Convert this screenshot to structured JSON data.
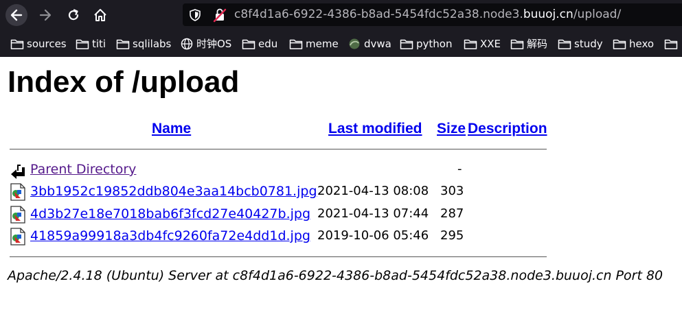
{
  "browser": {
    "url_prefix": "c8f4d1a6-6922-4386-b8ad-5454fdc52a38.node3.",
    "url_domain": "buuoj.cn",
    "url_path": "/upload/"
  },
  "bookmarks": [
    {
      "label": "sources",
      "icon": "folder-icon"
    },
    {
      "label": "titi",
      "icon": "folder-icon"
    },
    {
      "label": "sqlilabs",
      "icon": "folder-icon"
    },
    {
      "label": "时钟OS",
      "icon": "globe-icon"
    },
    {
      "label": "edu",
      "icon": "folder-icon"
    },
    {
      "label": "meme",
      "icon": "folder-icon"
    },
    {
      "label": "dvwa",
      "icon": "site-favicon-icon"
    },
    {
      "label": "python",
      "icon": "folder-icon"
    },
    {
      "label": "XXE",
      "icon": "folder-icon"
    },
    {
      "label": "解码",
      "icon": "folder-icon"
    },
    {
      "label": "study",
      "icon": "folder-icon"
    },
    {
      "label": "hexo",
      "icon": "folder-icon"
    }
  ],
  "page": {
    "title": "Index of /upload",
    "columns": {
      "name": "Name",
      "last_modified": "Last modified",
      "size": "Size",
      "description": "Description"
    },
    "parent": {
      "label": "Parent Directory",
      "size": "-"
    },
    "files": [
      {
        "name": "3bb1952c19852ddb804e3aa14bcb0781.jpg",
        "modified": "2021-04-13 08:08",
        "size": "303"
      },
      {
        "name": "4d3b27e18e7018bab6f3fcd27e40427b.jpg",
        "modified": "2021-04-13 07:44",
        "size": "287"
      },
      {
        "name": "41859a99918a3db4fc9260fa72e4dd1d.jpg",
        "modified": "2019-10-06 05:46",
        "size": "295"
      }
    ],
    "server_signature": "Apache/2.4.18 (Ubuntu) Server at c8f4d1a6-6922-4386-b8ad-5454fdc52a38.node3.buuoj.cn Port 80"
  }
}
